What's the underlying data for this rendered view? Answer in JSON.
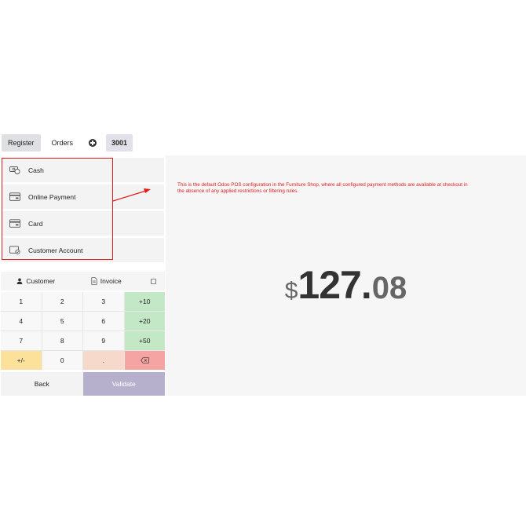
{
  "nav": {
    "register": "Register",
    "orders": "Orders",
    "order_number": "3001"
  },
  "payment_methods": [
    {
      "label": "Cash",
      "icon": "cash-icon"
    },
    {
      "label": "Online Payment",
      "icon": "card-terminal-icon"
    },
    {
      "label": "Card",
      "icon": "credit-card-icon"
    },
    {
      "label": "Customer Account",
      "icon": "customer-account-icon"
    }
  ],
  "customer_row": {
    "customer": "Customer",
    "invoice": "Invoice"
  },
  "numpad": {
    "k1": "1",
    "k2": "2",
    "k3": "3",
    "k10": "+10",
    "k4": "4",
    "k5": "5",
    "k6": "6",
    "k20": "+20",
    "k7": "7",
    "k8": "8",
    "k9": "9",
    "k50": "+50",
    "kpm": "+/-",
    "k0": "0",
    "kdot": "."
  },
  "actions": {
    "back": "Back",
    "validate": "Validate"
  },
  "annotation": "This is the default Odoo POS configuration in the Furniture Shop, where all configured payment methods are available at checkout in the absence of any applied restrictions or filtering rules.",
  "amount": {
    "currency": "$",
    "integer": "127",
    "dot": ".",
    "decimals": "08"
  },
  "colors": {
    "highlight": "#e21b1b",
    "validate": "#b6b0cc",
    "quick_add": "#c3e8c6",
    "backspace": "#f5a3a3"
  }
}
